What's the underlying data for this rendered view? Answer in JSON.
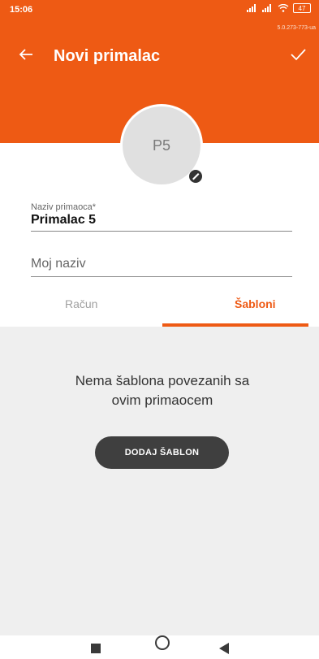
{
  "status_bar": {
    "time": "15:06",
    "battery": "47",
    "build": "5.0.273-773-ua"
  },
  "app_bar": {
    "title": "Novi primalac"
  },
  "avatar": {
    "initials": "P5"
  },
  "form": {
    "recipient_label": "Naziv primaoca*",
    "recipient_value": "Primalac 5",
    "my_name_placeholder": "Moj naziv"
  },
  "tabs": [
    {
      "label": "Račun",
      "active": false
    },
    {
      "label": "Šabloni",
      "active": true
    }
  ],
  "empty_state": {
    "message": "Nema šablona povezanih sa ovim primaocem",
    "button_label": "DODAJ ŠABLON"
  },
  "colors": {
    "accent": "#ee5a14",
    "button": "#3f3f3f",
    "background_empty": "#efefef"
  }
}
